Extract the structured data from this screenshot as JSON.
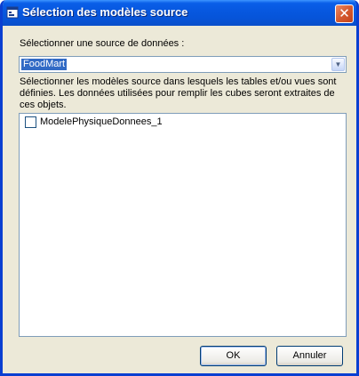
{
  "window": {
    "title": "Sélection des modèles source",
    "close_label": "✕"
  },
  "source": {
    "label": "Sélectionner une source de données :",
    "selected": "FoodMart"
  },
  "description": "Sélectionner les modèles source dans lesquels les tables et/ou vues sont définies. Les données utilisées pour remplir les cubes seront extraites de ces objets.",
  "models": [
    {
      "label": "ModelePhysiqueDonnees_1",
      "checked": false
    }
  ],
  "buttons": {
    "ok": "OK",
    "cancel": "Annuler"
  }
}
